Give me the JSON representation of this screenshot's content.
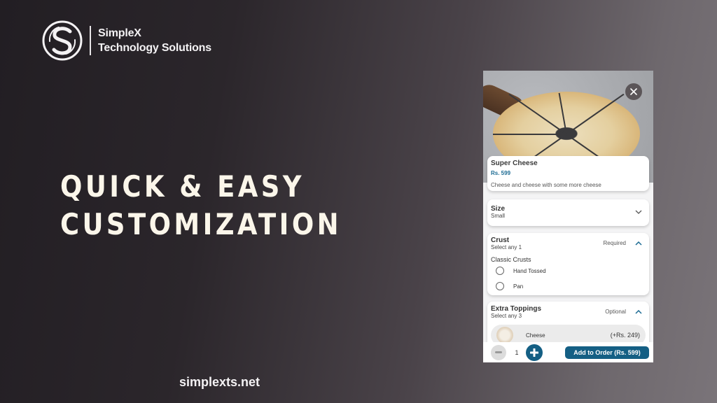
{
  "brand": {
    "name_line1": "SimpleX",
    "name_line2": "Technology Solutions",
    "logo_icon": "simplex-s-logo"
  },
  "headline": {
    "line1": "QUICK & EASY",
    "line2": "CUSTOMIZATION"
  },
  "footer": {
    "url": "simplexts.net"
  },
  "colors": {
    "accent": "#145f84",
    "price": "#1c6b93",
    "headline": "#fbf6ea"
  },
  "phone": {
    "hero": {
      "image": "pizza-photo",
      "close_icon": "close-icon"
    },
    "product": {
      "title": "Super Cheese",
      "price": "Rs. 599",
      "description": "Cheese and cheese with some more cheese"
    },
    "size": {
      "title": "Size",
      "selected": "Small",
      "icon": "chevron-down-icon"
    },
    "crust": {
      "title": "Crust",
      "subtitle": "Select any 1",
      "badge": "Required",
      "icon": "chevron-up-icon",
      "group_label": "Classic Crusts",
      "options": [
        {
          "label": "Hand Tossed",
          "selected": false
        },
        {
          "label": "Pan",
          "selected": false
        }
      ]
    },
    "toppings": {
      "title": "Extra Toppings",
      "subtitle": "Select any 3",
      "badge": "Optional",
      "icon": "chevron-up-icon",
      "items": [
        {
          "name": "Cheese",
          "price": "(+Rs. 249)"
        }
      ]
    },
    "order_bar": {
      "quantity": "1",
      "add_label": "Add to Order (Rs. 599)"
    }
  }
}
